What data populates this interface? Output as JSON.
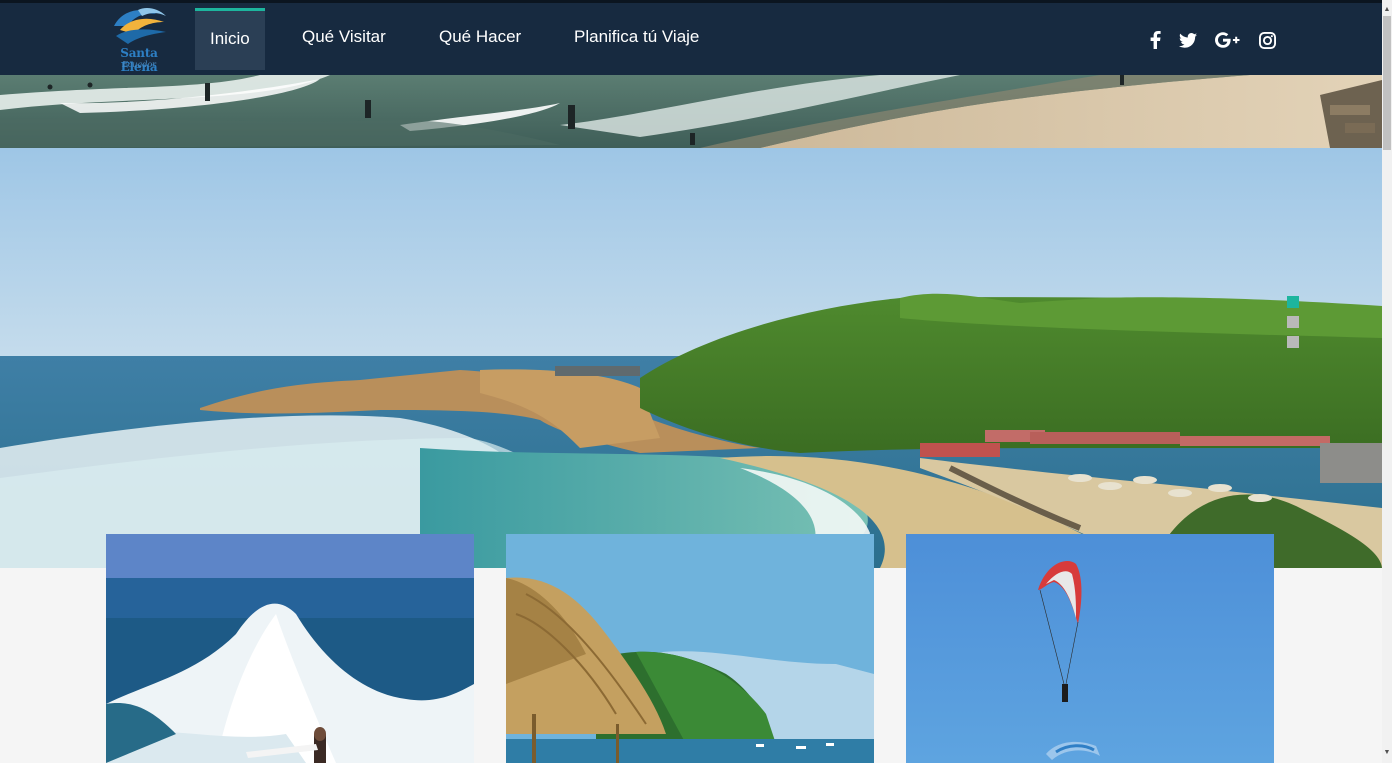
{
  "logo": {
    "title": "Santa Elena",
    "subtitle": "Ecuador"
  },
  "nav": {
    "items": [
      {
        "label": "Inicio",
        "active": true
      },
      {
        "label": "Qué Visitar",
        "active": false
      },
      {
        "label": "Qué Hacer",
        "active": false
      },
      {
        "label": "Planifica tú Viaje",
        "active": false
      }
    ]
  },
  "social": [
    "facebook-icon",
    "twitter-icon",
    "google-plus-icon",
    "instagram-icon"
  ],
  "slider": {
    "slide_count": 3,
    "active_slide": 1
  },
  "cards": [
    {
      "name": "surf-card",
      "image": "surfer-wave"
    },
    {
      "name": "beach-card",
      "image": "thatched-umbrella-bay"
    },
    {
      "name": "paragliding-card",
      "image": "paragliders-sky"
    }
  ],
  "colors": {
    "navbar": "#172a40",
    "accent": "#1db59e",
    "active_nav_bg": "#2b3f55",
    "text": "#ffffff"
  }
}
